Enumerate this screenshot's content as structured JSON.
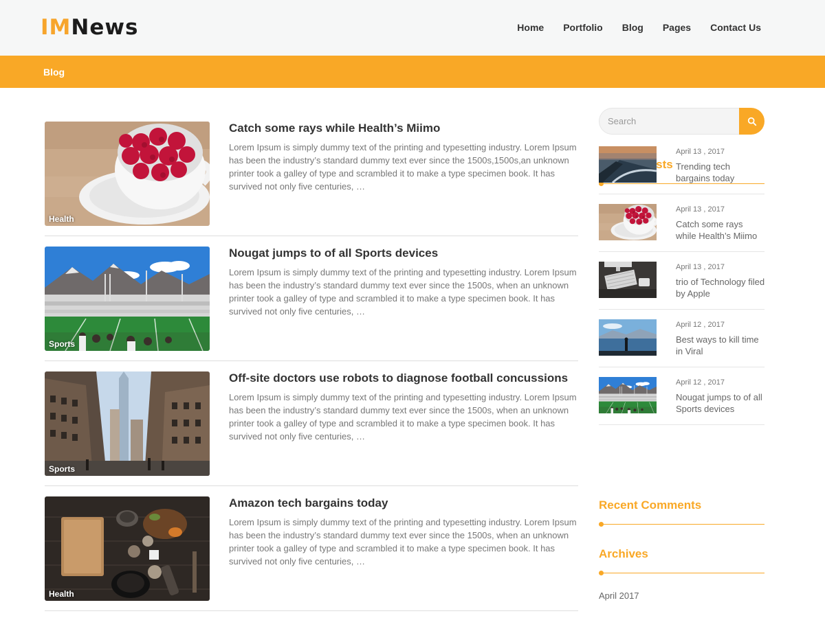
{
  "site": {
    "logo_part1": "IM",
    "logo_part2": "News"
  },
  "nav": [
    "Home",
    "Portfolio",
    "Blog",
    "Pages",
    "Contact Us"
  ],
  "breadcrumb": "Blog",
  "posts": [
    {
      "title": "Catch some rays while Health’s Miimo",
      "excerpt": "Lorem Ipsum is simply dummy text of the printing and typesetting industry. Lorem Ipsum has been the industry’s standard dummy text ever since the 1500s,1500s,an unknown printer took a galley of type and scrambled it to make a type specimen book. It has survived not only five centuries, …",
      "category": "Health",
      "image": "raspberries-cup"
    },
    {
      "title": "Nougat jumps to of all Sports devices",
      "excerpt": "Lorem Ipsum is simply dummy text of the printing and typesetting industry. Lorem Ipsum has been the industry’s standard dummy text ever since the 1500s, when an unknown printer took a galley of type and scrambled it to make a type specimen book. It has survived not only five centuries, …",
      "category": "Sports",
      "image": "stadium"
    },
    {
      "title": "Off-site doctors use robots to diagnose football concussions",
      "excerpt": "Lorem Ipsum is simply dummy text of the printing and typesetting industry. Lorem Ipsum has been the industry’s standard dummy text ever since the 1500s, when an unknown printer took a galley of type and scrambled it to make a type specimen book. It has survived not only five centuries, …",
      "category": "Sports",
      "image": "city-street"
    },
    {
      "title": "Amazon tech bargains today",
      "excerpt": "Lorem Ipsum is simply dummy text of the printing and typesetting industry. Lorem Ipsum has been the industry’s standard dummy text ever since the 1500s, when an unknown printer took a galley of type and scrambled it to make a type specimen book. It has survived not only five centuries, …",
      "category": "Health",
      "image": "kitchen-table"
    }
  ],
  "sidebar": {
    "search_placeholder": "Search",
    "search_icon": "search-icon",
    "recent_posts_title": "Recent Posts",
    "recent_posts": [
      {
        "date": "April 13 , 2017",
        "title": "Trending tech bargains today",
        "image": "aerial-road"
      },
      {
        "date": "April 13 , 2017",
        "title": "Catch some rays while Health’s Miimo",
        "image": "raspberries-cup"
      },
      {
        "date": "April 13 , 2017",
        "title": "trio of Technology filed by Apple",
        "image": "keyboard-desk"
      },
      {
        "date": "April 12 , 2017",
        "title": "Best ways to kill time in Viral",
        "image": "lake-person"
      },
      {
        "date": "April 12 , 2017",
        "title": "Nougat jumps to of all Sports devices",
        "image": "stadium"
      }
    ],
    "recent_comments_title": "Recent Comments",
    "archives_title": "Archives",
    "archives": [
      "April 2017"
    ]
  },
  "colors": {
    "accent": "#f9a826",
    "header_bg": "#f6f7f7",
    "text_dark": "#333333",
    "text_muted": "#777777"
  }
}
